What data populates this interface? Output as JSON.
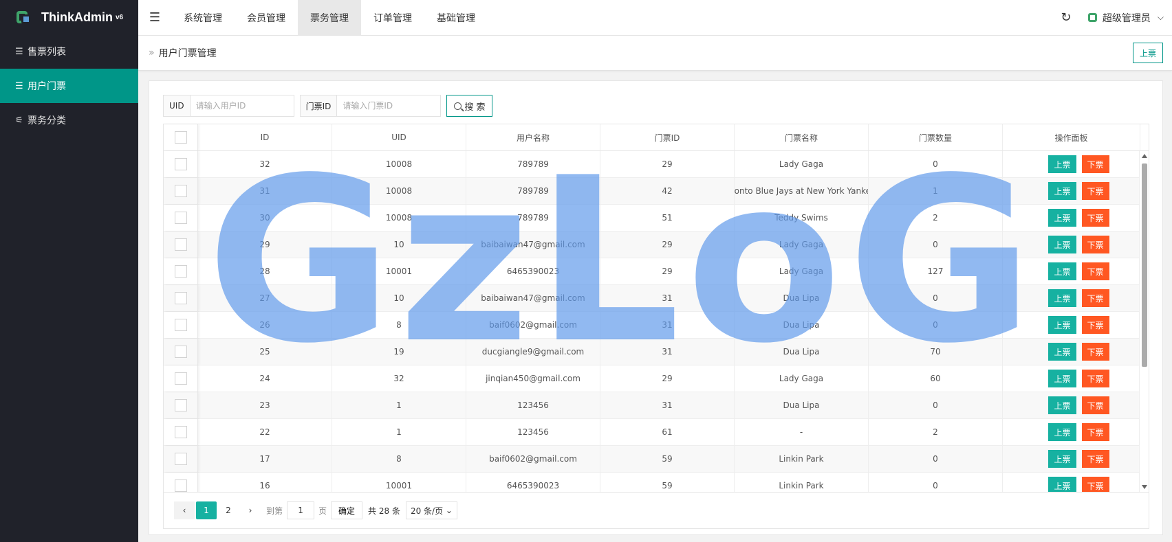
{
  "app": {
    "name": "ThinkAdmin",
    "version": "v6"
  },
  "sidebar": {
    "items": [
      {
        "label": "售票列表",
        "icon": "list-icon",
        "active": false
      },
      {
        "label": "用户门票",
        "icon": "list-icon",
        "active": true
      },
      {
        "label": "票务分类",
        "icon": "sliders-icon",
        "active": false
      }
    ]
  },
  "header": {
    "tabs": [
      {
        "label": "系统管理",
        "active": false
      },
      {
        "label": "会员管理",
        "active": false
      },
      {
        "label": "票务管理",
        "active": true
      },
      {
        "label": "订单管理",
        "active": false
      },
      {
        "label": "基础管理",
        "active": false
      }
    ],
    "user": "超级管理员"
  },
  "breadcrumb": {
    "title": "用户门票管理",
    "action_label": "上票"
  },
  "search": {
    "uid_label": "UID",
    "uid_placeholder": "请输入用户ID",
    "ticket_label": "门票ID",
    "ticket_placeholder": "请输入门票ID",
    "button_label": "搜 索"
  },
  "table": {
    "headers": [
      "ID",
      "UID",
      "用户名称",
      "门票ID",
      "门票名称",
      "门票数量",
      "操作面板"
    ],
    "up_label": "上票",
    "down_label": "下票",
    "rows": [
      [
        "32",
        "10008",
        "789789",
        "29",
        "Lady Gaga",
        "0"
      ],
      [
        "31",
        "10008",
        "789789",
        "42",
        "Toronto Blue Jays at New York Yankees",
        "1"
      ],
      [
        "30",
        "10008",
        "789789",
        "51",
        "Teddy Swims",
        "2"
      ],
      [
        "29",
        "10",
        "baibaiwan47@gmail.com",
        "29",
        "Lady Gaga",
        "0"
      ],
      [
        "28",
        "10001",
        "6465390023",
        "29",
        "Lady Gaga",
        "127"
      ],
      [
        "27",
        "10",
        "baibaiwan47@gmail.com",
        "31",
        "Dua Lipa",
        "0"
      ],
      [
        "26",
        "8",
        "baif0602@gmail.com",
        "31",
        "Dua Lipa",
        "0"
      ],
      [
        "25",
        "19",
        "ducgiangle9@gmail.com",
        "31",
        "Dua Lipa",
        "70"
      ],
      [
        "24",
        "32",
        "jinqian450@gmail.com",
        "29",
        "Lady Gaga",
        "60"
      ],
      [
        "23",
        "1",
        "123456",
        "31",
        "Dua Lipa",
        "0"
      ],
      [
        "22",
        "1",
        "123456",
        "61",
        "-",
        "2"
      ],
      [
        "17",
        "8",
        "baif0602@gmail.com",
        "59",
        "Linkin Park",
        "0"
      ],
      [
        "16",
        "10001",
        "6465390023",
        "59",
        "Linkin Park",
        "0"
      ]
    ]
  },
  "pagination": {
    "pages": [
      "1",
      "2"
    ],
    "current": "1",
    "goto_prefix": "到第",
    "goto_value": "1",
    "goto_suffix": "页",
    "confirm_label": "确定",
    "total_text": "共 28 条",
    "page_size": "20 条/页"
  },
  "watermark": "GzLoG",
  "colors": {
    "sidebar": "#20222a",
    "accent": "#009688",
    "up_button": "#16b1a1",
    "down_button": "#ff5722"
  }
}
